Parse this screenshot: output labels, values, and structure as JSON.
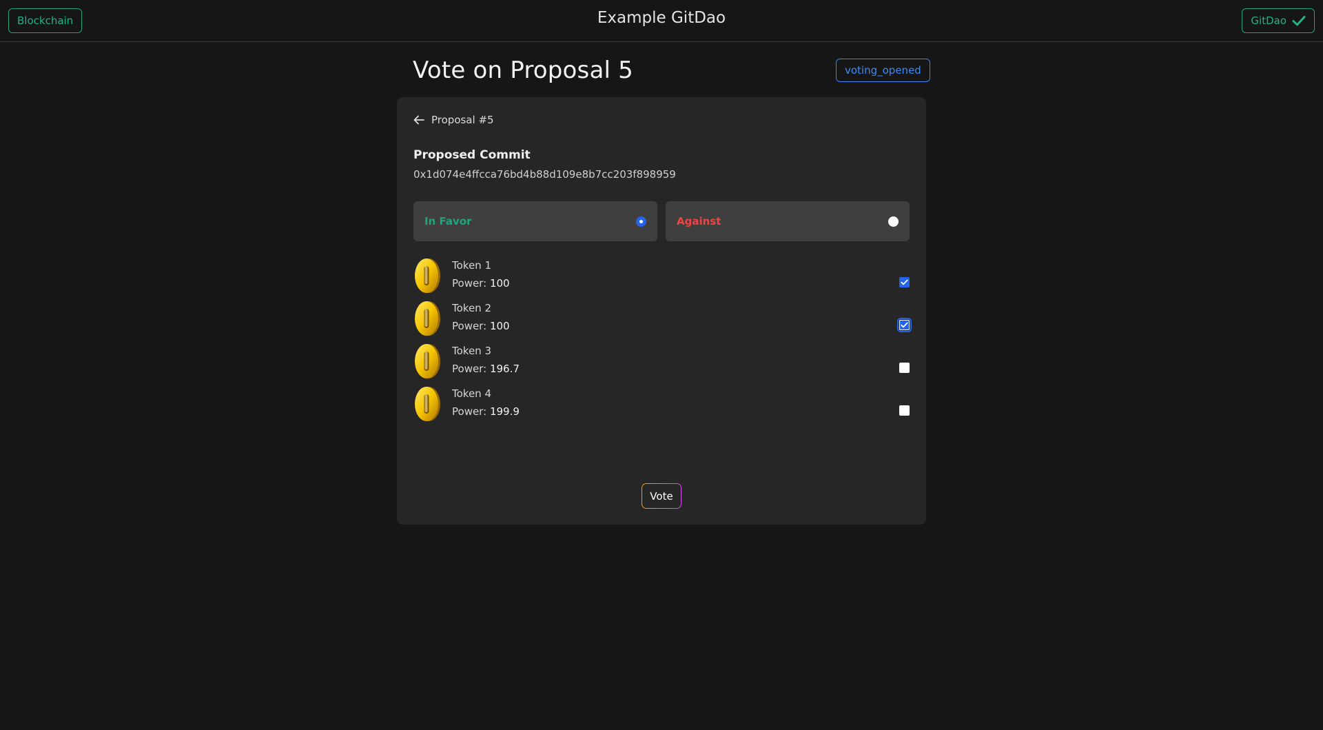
{
  "header": {
    "blockchain_label": "Blockchain",
    "title": "Example GitDao",
    "gitdao_label": "GitDao"
  },
  "page": {
    "heading": "Vote on Proposal 5",
    "status": "voting_opened"
  },
  "card": {
    "back_label": "Proposal #5",
    "commit_label": "Proposed Commit",
    "commit_hash": "0x1d074e4ffcca76bd4b88d109e8b7cc203f898959",
    "choices": {
      "favor_label": "In Favor",
      "favor_selected": true,
      "against_label": "Against",
      "against_selected": false
    },
    "power_label": "Power:",
    "tokens": [
      {
        "name": "Token 1",
        "power": "100",
        "checked": true
      },
      {
        "name": "Token 2",
        "power": "100",
        "checked": true
      },
      {
        "name": "Token 3",
        "power": "196.7",
        "checked": false
      },
      {
        "name": "Token 4",
        "power": "199.9",
        "checked": false
      }
    ],
    "vote_label": "Vote"
  },
  "colors": {
    "accent_green": "#1fa57e",
    "status_blue": "#3b82f6",
    "against_red": "#ef4444",
    "background": "#161616",
    "card": "#262626"
  },
  "icons": {
    "check": "check-icon",
    "back": "arrow-left-icon",
    "token": "coin-icon"
  }
}
